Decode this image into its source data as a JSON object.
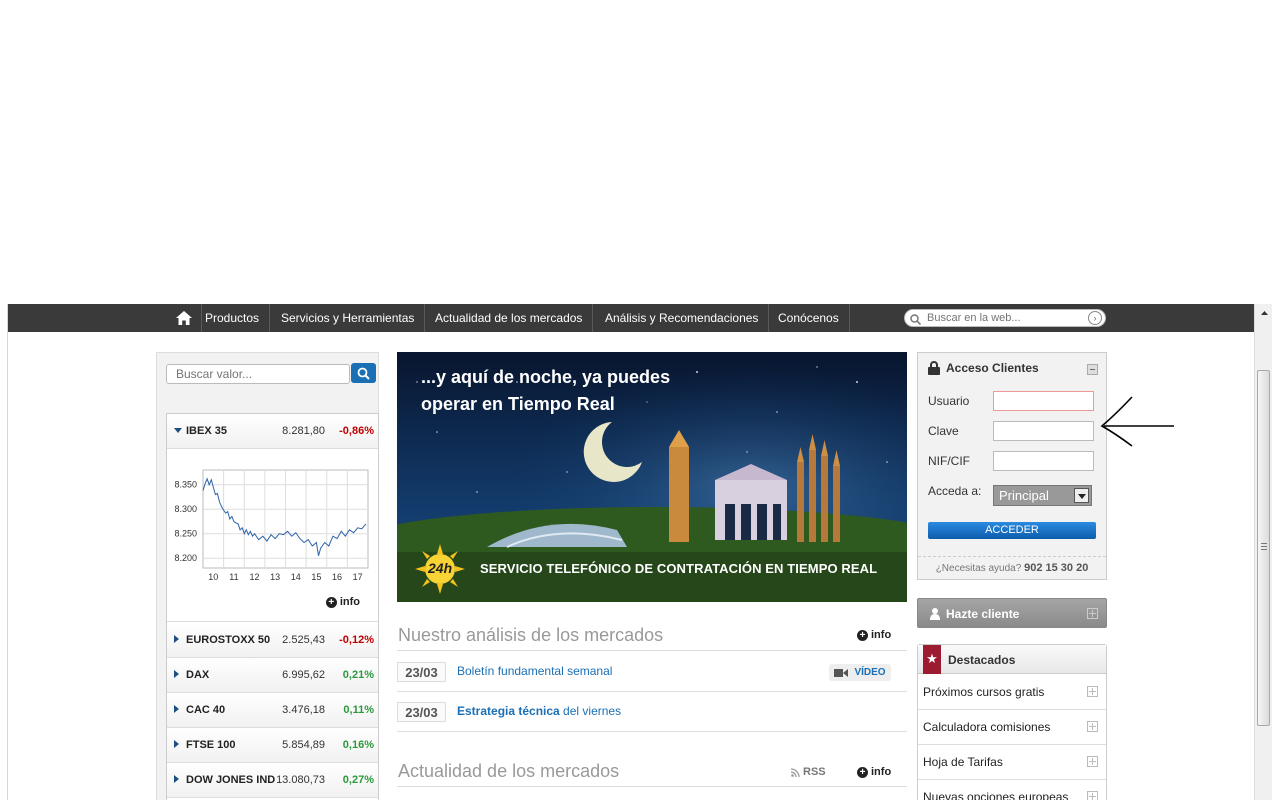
{
  "nav": {
    "items": [
      "Productos",
      "Servicios y Herramientas",
      "Actualidad de los mercados",
      "Análisis y Recomendaciones",
      "Conócenos"
    ],
    "search_placeholder": "Buscar en la web..."
  },
  "quote_search": {
    "placeholder": "Buscar valor..."
  },
  "markets": [
    {
      "name": "IBEX 35",
      "value": "8.281,80",
      "change": "-0,86%",
      "direction": "neg",
      "expanded": true
    },
    {
      "name": "EUROSTOXX 50",
      "value": "2.525,43",
      "change": "-0,12%",
      "direction": "neg"
    },
    {
      "name": "DAX",
      "value": "6.995,62",
      "change": "0,21%",
      "direction": "pos"
    },
    {
      "name": "CAC 40",
      "value": "3.476,18",
      "change": "0,11%",
      "direction": "pos"
    },
    {
      "name": "FTSE 100",
      "value": "5.854,89",
      "change": "0,16%",
      "direction": "pos"
    },
    {
      "name": "DOW JONES IND",
      "value": "13.080,73",
      "change": "0,27%",
      "direction": "pos"
    }
  ],
  "chart_data": {
    "type": "line",
    "xticks": [
      "10",
      "11",
      "12",
      "13",
      "14",
      "15",
      "16",
      "17"
    ],
    "yticks": [
      "8.350",
      "8.300",
      "8.250",
      "8.200"
    ],
    "ylim": [
      8180,
      8380
    ],
    "xlim": [
      9.5,
      17.5
    ],
    "series": [
      {
        "values": [
          [
            9.5,
            8338
          ],
          [
            9.6,
            8352
          ],
          [
            9.7,
            8362
          ],
          [
            9.8,
            8350
          ],
          [
            9.9,
            8360
          ],
          [
            10.0,
            8345
          ],
          [
            10.1,
            8330
          ],
          [
            10.2,
            8332
          ],
          [
            10.3,
            8315
          ],
          [
            10.4,
            8305
          ],
          [
            10.5,
            8298
          ],
          [
            10.6,
            8292
          ],
          [
            10.7,
            8295
          ],
          [
            10.8,
            8280
          ],
          [
            10.9,
            8285
          ],
          [
            11.0,
            8275
          ],
          [
            11.1,
            8272
          ],
          [
            11.2,
            8270
          ],
          [
            11.3,
            8258
          ],
          [
            11.4,
            8262
          ],
          [
            11.5,
            8250
          ],
          [
            11.6,
            8258
          ],
          [
            11.7,
            8248
          ],
          [
            11.8,
            8255
          ],
          [
            11.9,
            8245
          ],
          [
            12.0,
            8250
          ],
          [
            12.2,
            8238
          ],
          [
            12.4,
            8245
          ],
          [
            12.6,
            8235
          ],
          [
            12.8,
            8248
          ],
          [
            13.0,
            8240
          ],
          [
            13.2,
            8250
          ],
          [
            13.4,
            8248
          ],
          [
            13.6,
            8255
          ],
          [
            13.8,
            8245
          ],
          [
            14.0,
            8252
          ],
          [
            14.2,
            8240
          ],
          [
            14.4,
            8232
          ],
          [
            14.6,
            8238
          ],
          [
            14.8,
            8225
          ],
          [
            15.0,
            8232
          ],
          [
            15.1,
            8205
          ],
          [
            15.2,
            8220
          ],
          [
            15.4,
            8232
          ],
          [
            15.6,
            8225
          ],
          [
            15.8,
            8245
          ],
          [
            16.0,
            8240
          ],
          [
            16.2,
            8255
          ],
          [
            16.4,
            8245
          ],
          [
            16.6,
            8258
          ],
          [
            16.8,
            8252
          ],
          [
            17.0,
            8262
          ],
          [
            17.2,
            8260
          ],
          [
            17.4,
            8270
          ]
        ]
      }
    ]
  },
  "chart_info_label": "info",
  "banner": {
    "headline_1": "...y aquí de noche, ya puedes",
    "headline_2": "operar en Tiempo Real",
    "badge": "24h",
    "bottom": "SERVICIO TELEFÓNICO DE CONTRATACIÓN EN TIEMPO REAL"
  },
  "analysis": {
    "title": "Nuestro análisis de los mercados",
    "info_label": "info",
    "items": [
      {
        "date": "23/03",
        "title": "Boletín fundamental semanal",
        "video": "VÍDEO"
      },
      {
        "date": "23/03",
        "title_bold": "Estrategia técnica",
        "title_rest": " del viernes"
      }
    ]
  },
  "news": {
    "title": "Actualidad de los mercados",
    "rss_label": "RSS",
    "info_label": "info"
  },
  "login": {
    "title": "Acceso Clientes",
    "user_label": "Usuario",
    "password_label": "Clave",
    "nif_label": "NIF/CIF",
    "access_label": "Acceda a:",
    "access_value": "Principal",
    "submit": "ACCEDER",
    "help_text": "¿Necesitas ayuda?",
    "help_phone": "902 15 30 20"
  },
  "signup": {
    "label": "Hazte cliente"
  },
  "featured": {
    "title": "Destacados",
    "items": [
      "Próximos cursos gratis",
      "Calculadora comisiones",
      "Hoja de Tarifas",
      "Nuevas opciones europeas"
    ]
  },
  "colors": {
    "nav_bg": "#3a3a3a",
    "link": "#1a6fb5",
    "negative": "#c00000",
    "positive": "#2b9a3b",
    "featured_accent": "#9b1b30"
  }
}
